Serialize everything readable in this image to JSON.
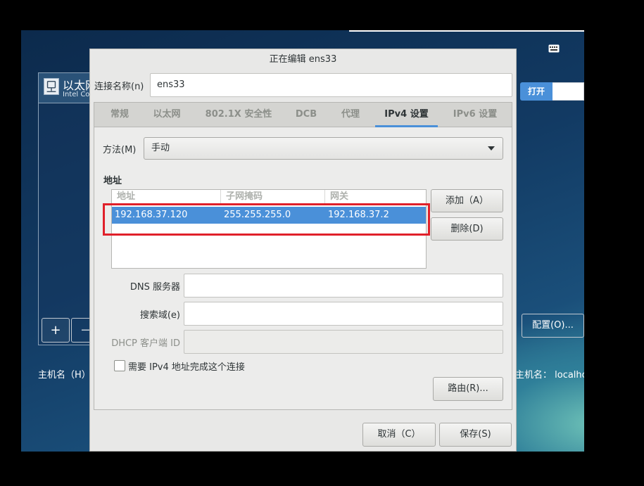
{
  "background": {
    "ethernet_title": "以太网",
    "ethernet_subtitle": "Intel Corporation",
    "add_symbol": "+",
    "remove_symbol": "−",
    "hostname_left_label": "主机名（H）",
    "toggle_on_label": "打开",
    "configure_button": "配置(O)...",
    "hostname_right": "主机名：   localhost"
  },
  "dialog": {
    "title": "正在编辑 ens33",
    "connection_name_label": "连接名称(n)",
    "connection_name_value": "ens33",
    "tabs": [
      "常规",
      "以太网",
      "802.1X 安全性",
      "DCB",
      "代理",
      "IPv4 设置",
      "IPv6 设置"
    ],
    "active_tab": "IPv4 设置",
    "method_label": "方法(M)",
    "method_value": "手动",
    "addresses_heading": "地址",
    "table_headers": [
      "地址",
      "子网掩码",
      "网关"
    ],
    "addresses": [
      {
        "address": "192.168.37.120",
        "netmask": "255.255.255.0",
        "gateway": "192.168.37.2"
      }
    ],
    "add_button": "添加（A）",
    "delete_button": "删除(D)",
    "dns_label": "DNS 服务器",
    "dns_value": "",
    "search_domain_label": "搜索域(e)",
    "search_domain_value": "",
    "dhcp_client_id_label": "DHCP 客户端 ID",
    "dhcp_client_id_value": "",
    "require_ipv4_label": "需要 IPv4 地址完成这个连接",
    "require_ipv4_checked": false,
    "routes_button": "路由(R)...",
    "cancel_button": "取消（C）",
    "save_button": "保存(S)"
  },
  "colors": {
    "accent": "#4a90d9",
    "highlight_box": "#e0202a",
    "dialog_bg": "#e8e8e7"
  }
}
